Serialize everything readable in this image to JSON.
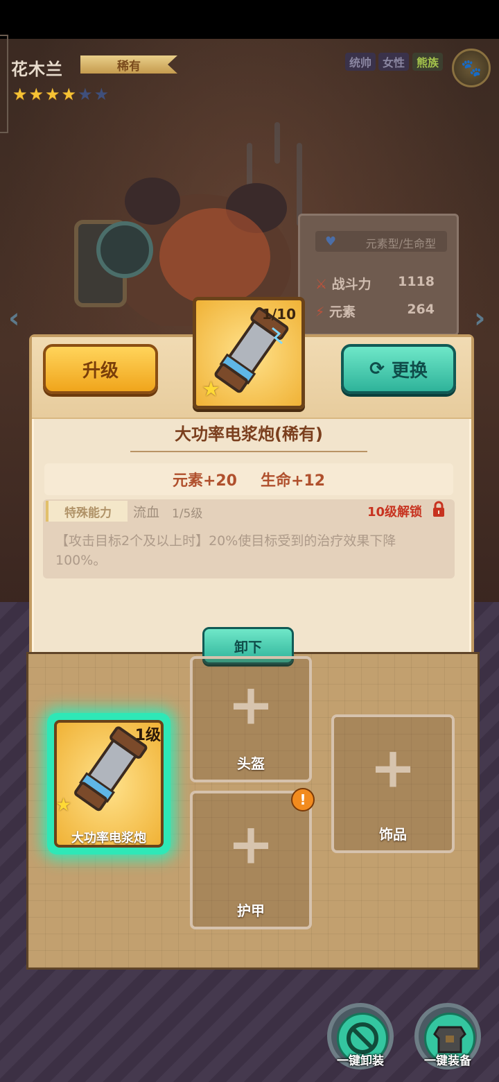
{
  "hero": {
    "name": "花木兰",
    "rarity": "稀有",
    "stars_filled": 4,
    "stars_total": 6,
    "tags": [
      "统帅",
      "女性"
    ],
    "race": "熊族"
  },
  "stats": {
    "type": "元素型/生命型",
    "rows": [
      {
        "label": "战斗力",
        "value": "1118"
      },
      {
        "label": "元素",
        "value": "264"
      }
    ]
  },
  "detail": {
    "upgrade_label": "升级",
    "replace_label": "更换",
    "item_level": "1/10",
    "item_title": "大功率电浆炮(稀有)",
    "attr1": "元素+20",
    "attr2": "生命+12",
    "skill_label": "特殊能力",
    "skill_name": "流血",
    "skill_level": "1/5级",
    "skill_lock": "10级解锁",
    "skill_desc": "【攻击目标2个及以上时】20%使目标受到的治疗效果下降100%。",
    "unequip_label": "卸下"
  },
  "slots": {
    "equipped": {
      "level": "1级",
      "name": "大功率电浆炮"
    },
    "helmet": "头盔",
    "accessory": "饰品",
    "armor": "护甲"
  },
  "footer": {
    "unequip_all": "一键卸装",
    "equip_all": "一键装备"
  },
  "colors": {
    "accent_teal": "#2fb39a",
    "accent_gold": "#f0a51c",
    "lock_red": "#c73320"
  }
}
